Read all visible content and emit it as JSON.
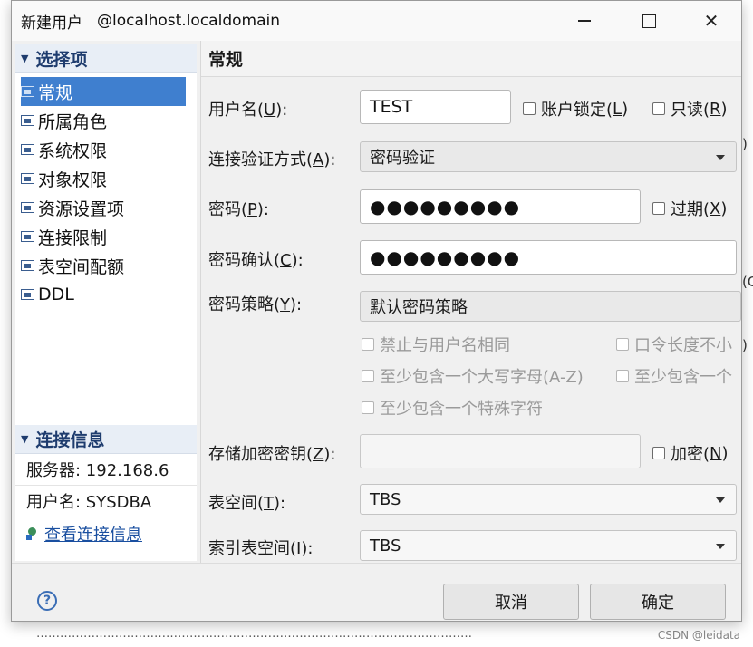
{
  "window": {
    "title": "新建用户",
    "host": "@localhost.localdomain"
  },
  "nav": {
    "section_label": "选择项",
    "items": [
      {
        "label": "常规",
        "selected": true
      },
      {
        "label": "所属角色"
      },
      {
        "label": "系统权限"
      },
      {
        "label": "对象权限"
      },
      {
        "label": "资源设置项"
      },
      {
        "label": "连接限制"
      },
      {
        "label": "表空间配额"
      },
      {
        "label": "DDL"
      }
    ]
  },
  "conn_info": {
    "section_label": "连接信息",
    "server": "服务器: 192.168.6",
    "user": "用户名: SYSDBA",
    "link": "查看连接信息"
  },
  "main": {
    "header": "常规",
    "username": {
      "label": "用户名(",
      "key": "U",
      "end": "):",
      "value": "TEST"
    },
    "account_lock": {
      "label": "账户锁定(",
      "key": "L",
      "end": ")"
    },
    "read_only": {
      "label": "只读(",
      "key": "R",
      "end": ")"
    },
    "auth_method": {
      "label": "连接验证方式(",
      "key": "A",
      "end": "):",
      "value": "密码验证"
    },
    "password": {
      "label": "密码(",
      "key": "P",
      "end": "):",
      "value": "●●●●●●●●●"
    },
    "expire": {
      "label": "过期(",
      "key": "X",
      "end": ")"
    },
    "password_confirm": {
      "label": "密码确认(",
      "key": "C",
      "end": "):",
      "value": "●●●●●●●●●"
    },
    "policy": {
      "label": "密码策略(",
      "key": "Y",
      "end": "):",
      "value": "默认密码策略"
    },
    "policy_options": [
      "禁止与用户名相同",
      "口令长度不小",
      "至少包含一个大写字母(A-Z)",
      "至少包含一个",
      "至少包含一个特殊字符"
    ],
    "storage_key": {
      "label": "存储加密密钥(",
      "key": "Z",
      "end": "):",
      "value": ""
    },
    "encrypt": {
      "label": "加密(",
      "key": "N",
      "end": ")"
    },
    "tablespace": {
      "label": "表空间(",
      "key": "T",
      "end": "):",
      "value": "TBS"
    },
    "index_tablespace": {
      "label": "索引表空间(",
      "key": "I",
      "end": "):",
      "value": "TBS"
    }
  },
  "footer": {
    "help": "?",
    "cancel": "取消",
    "ok": "确定"
  },
  "background": {
    "frag1": ")",
    "frag2": "(C",
    "frag3": ")",
    "bottom_text": "…………………………………………………………………………………………………",
    "watermark": "CSDN @leidata"
  }
}
